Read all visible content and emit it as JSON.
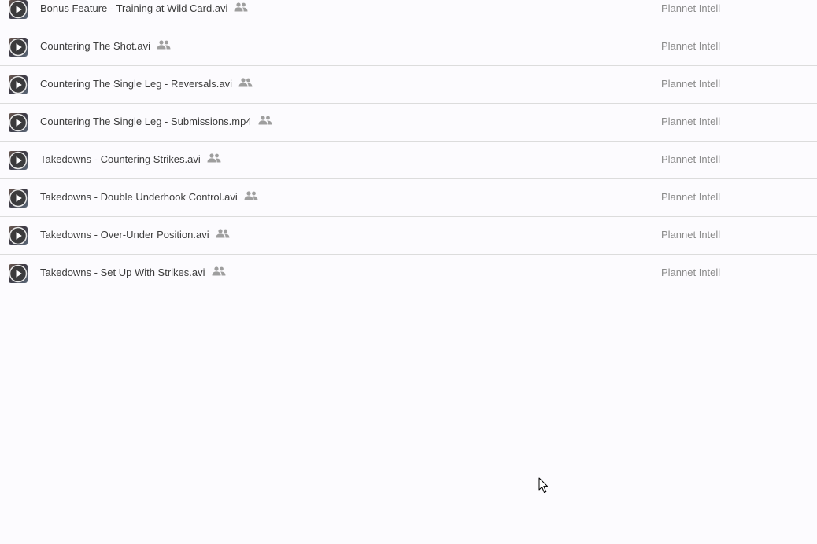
{
  "file_list": {
    "rows": [
      {
        "name": "Bonus Feature - Training at Wild Card.avi",
        "owner": "Plannet Intell",
        "icon": "video-play-icon",
        "shared_icon": "people-shared-icon"
      },
      {
        "name": "Countering The Shot.avi",
        "owner": "Plannet Intell",
        "icon": "video-play-icon",
        "shared_icon": "people-shared-icon"
      },
      {
        "name": "Countering The Single Leg - Reversals.avi",
        "owner": "Plannet Intell",
        "icon": "video-play-icon",
        "shared_icon": "people-shared-icon"
      },
      {
        "name": "Countering The Single Leg - Submissions.mp4",
        "owner": "Plannet Intell",
        "icon": "video-play-icon",
        "shared_icon": "people-shared-icon"
      },
      {
        "name": "Takedowns - Countering Strikes.avi",
        "owner": "Plannet Intell",
        "icon": "video-play-icon",
        "shared_icon": "people-shared-icon"
      },
      {
        "name": "Takedowns - Double Underhook Control.avi",
        "owner": "Plannet Intell",
        "icon": "video-play-icon",
        "shared_icon": "people-shared-icon"
      },
      {
        "name": "Takedowns - Over-Under Position.avi",
        "owner": "Plannet Intell",
        "icon": "video-play-icon",
        "shared_icon": "people-shared-icon"
      },
      {
        "name": "Takedowns - Set Up With Strikes.avi",
        "owner": "Plannet Intell",
        "icon": "video-play-icon",
        "shared_icon": "people-shared-icon"
      }
    ]
  },
  "colors": {
    "background": "#fcfbfe",
    "row_divider": "#dcdcdc",
    "file_name_text": "#3c3c3c",
    "owner_text": "#8a8a8a",
    "shared_icon": "#9e9e9e"
  },
  "cursor": {
    "icon": "mouse-pointer-icon"
  }
}
